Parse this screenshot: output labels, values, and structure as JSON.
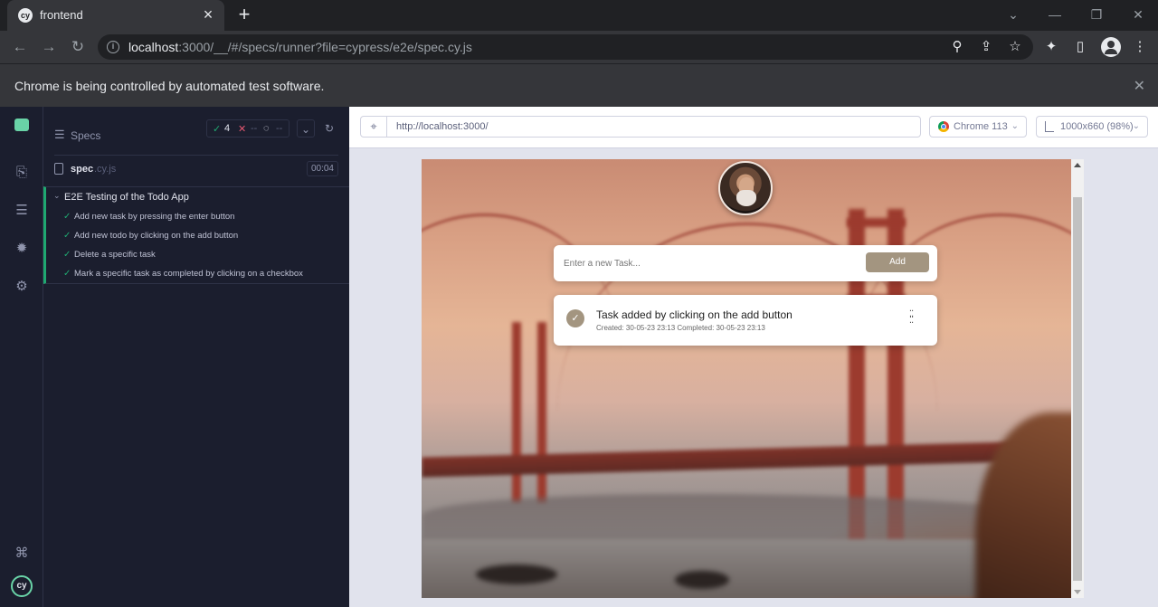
{
  "browser": {
    "tab_title": "frontend",
    "tab_favicon": "cy",
    "url_host": "localhost",
    "url_rest": ":3000/__/#/specs/runner?file=cypress/e2e/spec.cy.js",
    "infobar_text": "Chrome is being controlled by automated test software.",
    "icons": [
      "back-icon",
      "forward-icon",
      "reload-icon",
      "info-icon",
      "zoom-icon",
      "share-icon",
      "star-icon",
      "extensions-icon",
      "side-panel-icon",
      "profile-icon",
      "menu-icon"
    ]
  },
  "reporter": {
    "specs_label": "Specs",
    "stats": {
      "passed": "4",
      "failed": "--",
      "pending": "--"
    },
    "spec_name": "spec",
    "spec_ext": ".cy.js",
    "duration": "00:04",
    "suite_title": "E2E Testing of the Todo App",
    "tests": [
      {
        "title": "Add new task by pressing the enter button",
        "state": "passed"
      },
      {
        "title": "Add new todo by clicking on the add button",
        "state": "passed"
      },
      {
        "title": "Delete a specific task",
        "state": "passed"
      },
      {
        "title": "Mark a specific task as completed by clicking on a checkbox",
        "state": "passed"
      }
    ]
  },
  "aut": {
    "url": "http://localhost:3000/",
    "browser_label": "Chrome 113",
    "viewport_label": "1000x660 (98%)"
  },
  "app": {
    "input_placeholder": "Enter a new Task...",
    "add_label": "Add",
    "task": {
      "text": "Task added by clicking on the add button",
      "meta": "Created: 30-05-23 23:13   Completed: 30-05-23 23:13",
      "completed": true
    }
  },
  "colors": {
    "cypress_green": "#1fa971",
    "cypress_bg": "#1b1e2e",
    "add_button": "#a39580"
  }
}
